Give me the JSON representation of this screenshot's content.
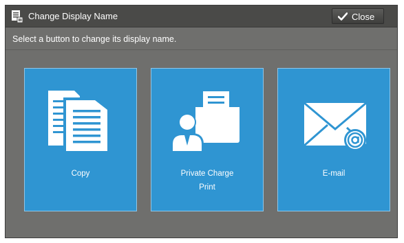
{
  "dialog": {
    "title": "Change Display Name",
    "title_icon": "display-name-icon",
    "close_label": "Close",
    "close_icon": "checkmark-icon"
  },
  "instruction": "Select a button to change its display name.",
  "tiles": [
    {
      "label": "Copy",
      "icon": "copy-documents-icon"
    },
    {
      "label_line1": "Private Charge",
      "label_line2": "Print",
      "icon": "private-charge-print-icon"
    },
    {
      "label": "E-mail",
      "icon": "email-envelope-icon"
    }
  ],
  "colors": {
    "tile_blue": "#2f95d2",
    "panel_gray": "#6f6f6d",
    "titlebar_gray": "#4a4a48"
  }
}
